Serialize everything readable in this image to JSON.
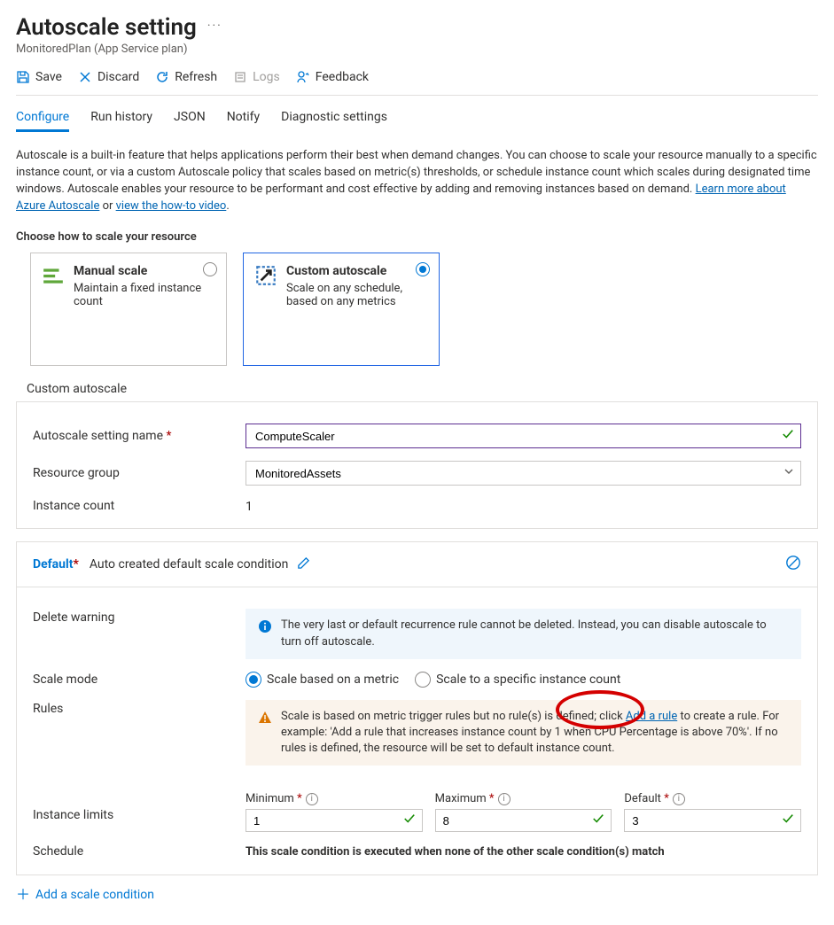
{
  "header": {
    "title": "Autoscale setting",
    "subtitle": "MonitoredPlan (App Service plan)"
  },
  "toolbar": {
    "save": "Save",
    "discard": "Discard",
    "refresh": "Refresh",
    "logs": "Logs",
    "feedback": "Feedback"
  },
  "tabs": {
    "configure": "Configure",
    "run_history": "Run history",
    "json": "JSON",
    "notify": "Notify",
    "diagnostic": "Diagnostic settings"
  },
  "intro": {
    "text1": "Autoscale is a built-in feature that helps applications perform their best when demand changes. You can choose to scale your resource manually to a specific instance count, or via a custom Autoscale policy that scales based on metric(s) thresholds, or schedule instance count which scales during designated time windows. Autoscale enables your resource to be performant and cost effective by adding and removing instances based on demand. ",
    "link1": "Learn more about Azure Autoscale",
    "text2": " or ",
    "link2": "view the how-to video",
    "text3": "."
  },
  "choose_label": "Choose how to scale your resource",
  "cards": {
    "manual": {
      "title": "Manual scale",
      "desc": "Maintain a fixed instance count"
    },
    "custom": {
      "title": "Custom autoscale",
      "desc": "Scale on any schedule, based on any metrics"
    }
  },
  "custom_heading": "Custom autoscale",
  "form": {
    "name_label": "Autoscale setting name",
    "name_value": "ComputeScaler",
    "rg_label": "Resource group",
    "rg_value": "MonitoredAssets",
    "count_label": "Instance count",
    "count_value": "1"
  },
  "condition": {
    "title": "Default",
    "subtitle": "Auto created default scale condition",
    "delete_warning_label": "Delete warning",
    "delete_warning_msg": "The very last or default recurrence rule cannot be deleted. Instead, you can disable autoscale to turn off autoscale.",
    "scale_mode_label": "Scale mode",
    "scale_mode_metric": "Scale based on a metric",
    "scale_mode_count": "Scale to a specific instance count",
    "rules_label": "Rules",
    "rules_msg_before": "Scale is based on metric trigger rules but no rule(s) is defined; click ",
    "rules_link": "Add a rule",
    "rules_msg_after": " to create a rule. For example: 'Add a rule that increases instance count by 1 when CPU Percentage is above 70%'. If no rules is defined, the resource will be set to default instance count.",
    "instance_limits_label": "Instance limits",
    "min_label": "Minimum",
    "min_value": "1",
    "max_label": "Maximum",
    "max_value": "8",
    "def_label": "Default",
    "def_value": "3",
    "schedule_label": "Schedule",
    "schedule_text": "This scale condition is executed when none of the other scale condition(s) match"
  },
  "add_condition": "Add a scale condition"
}
